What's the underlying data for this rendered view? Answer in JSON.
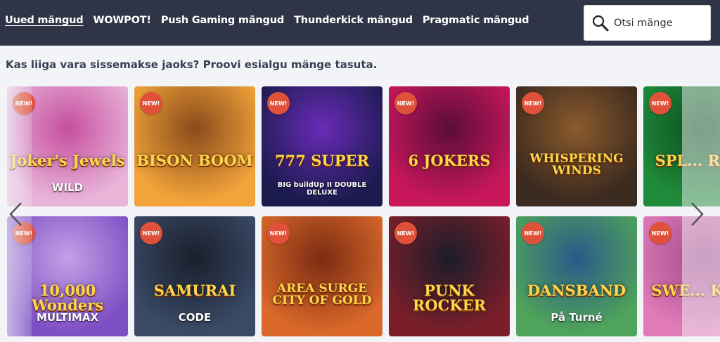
{
  "nav": {
    "items": [
      {
        "label": "Uued mängud",
        "active": true
      },
      {
        "label": "WOWPOT!",
        "active": false
      },
      {
        "label": "Push Gaming mängud",
        "active": false
      },
      {
        "label": "Thunderkick mängud",
        "active": false
      },
      {
        "label": "Pragmatic mängud",
        "active": false
      }
    ]
  },
  "search": {
    "placeholder": "Otsi mänge",
    "icon": "search-icon"
  },
  "promo_text": "Kas liiga vara sissemakse jaoks? Proovi esialgu mänge tasuta.",
  "badge_label": "NEW!",
  "games": [
    {
      "title": "Joker's Jewels",
      "subtitle": "WILD",
      "colors": [
        "#e8b4d8",
        "#c64fa0"
      ]
    },
    {
      "title": "BISON BOOM",
      "subtitle": "",
      "colors": [
        "#f2a43a",
        "#8a4a1b"
      ]
    },
    {
      "title": "777 SUPER",
      "subtitle": "BIG buildUp II DOUBLE DELUXE",
      "colors": [
        "#1c1b4f",
        "#6a2bb8"
      ]
    },
    {
      "title": "6 JOKERS",
      "subtitle": "",
      "colors": [
        "#c8175b",
        "#5a0d3a"
      ]
    },
    {
      "title": "WHISPERING WINDS",
      "subtitle": "",
      "colors": [
        "#3b2a1f",
        "#8a5a2c"
      ]
    },
    {
      "title": "SPL... RICH",
      "subtitle": "",
      "colors": [
        "#1f8b3a",
        "#0c4a1e"
      ]
    },
    {
      "title": "10,000 Wonders",
      "subtitle": "MULTIMAX",
      "colors": [
        "#7e4fc4",
        "#c4a0e6"
      ]
    },
    {
      "title": "SAMURAI",
      "subtitle": "CODE",
      "colors": [
        "#3a4a66",
        "#1a1f2c"
      ]
    },
    {
      "title": "AREA SURGE CITY OF GOLD",
      "subtitle": "",
      "colors": [
        "#d9682a",
        "#7a2b12"
      ]
    },
    {
      "title": "PUNK ROCKER",
      "subtitle": "",
      "colors": [
        "#7a1f2a",
        "#1c1c2a"
      ]
    },
    {
      "title": "DANSBAND",
      "subtitle": "På Turné",
      "colors": [
        "#4fa35a",
        "#2a5a8a"
      ]
    },
    {
      "title": "SWE... KING",
      "subtitle": "",
      "colors": [
        "#e07ab8",
        "#a04a8a"
      ]
    }
  ]
}
